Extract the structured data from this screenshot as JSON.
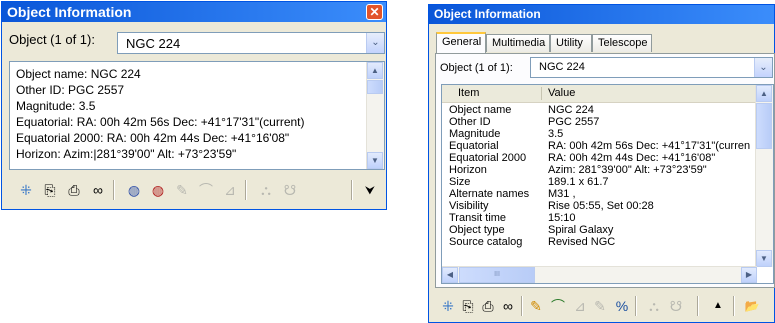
{
  "left_window": {
    "title": "Object Information",
    "close": "✕",
    "object_label": "Object (1 of 1):",
    "object_value": "NGC 224",
    "combo_arrow": "⌄",
    "text_lines": [
      "Object name: NGC 224",
      "Other ID: PGC 2557",
      "Magnitude: 3.5",
      "Equatorial: RA: 00h 42m 56s  Dec: +41°17'31\"(current)",
      "Equatorial 2000: RA: 00h 42m 44s  Dec: +41°16'08\"",
      "Horizon: Azim:|281°39'00\"  Alt: +73°23'59\""
    ],
    "scroll_up": "▲",
    "scroll_down": "▼",
    "toolbar": {
      "center": "⁜",
      "copy": "⎘",
      "print": "⎙",
      "binoculars": "∞",
      "globe_blue": "◍",
      "globe_red": "◍",
      "tool_a": "✎",
      "tool_b": "⌒",
      "tool_c": "⊿",
      "tool_d": "⛬",
      "tool_e": "☋",
      "more": "⮟"
    }
  },
  "right_window": {
    "title": "Object Information",
    "tabs": [
      "General",
      "Multimedia",
      "Utility",
      "Telescope"
    ],
    "object_label": "Object (1 of 1):",
    "object_value": "NGC 224",
    "combo_arrow": "⌄",
    "columns": [
      "Item",
      "Value"
    ],
    "rows": [
      [
        "Object name",
        "NGC 224"
      ],
      [
        "Other ID",
        "PGC 2557"
      ],
      [
        "Magnitude",
        "3.5"
      ],
      [
        "Equatorial",
        "RA: 00h 42m 56s  Dec: +41°17'31\"(curren"
      ],
      [
        "Equatorial 2000",
        "RA: 00h 42m 44s  Dec: +41°16'08\""
      ],
      [
        "Horizon",
        "Azim: 281°39'00\"  Alt: +73°23'59\""
      ],
      [
        "Size",
        "189.1 x 61.7"
      ],
      [
        "Alternate names",
        "M31 ,"
      ],
      [
        "Visibility",
        "Rise 05:55, Set 00:28"
      ],
      [
        "Transit time",
        "15:10"
      ],
      [
        "Object type",
        "Spiral Galaxy"
      ],
      [
        "Source catalog",
        "Revised NGC"
      ]
    ],
    "scroll_up": "▲",
    "scroll_down": "▼",
    "scroll_left": "◀",
    "scroll_right": "▶",
    "hthumb_grip": "III",
    "toolbar": {
      "center": "⁜",
      "copy": "⎘",
      "print": "⎙",
      "binoculars": "∞",
      "tool_a": "✎",
      "tool_b": "⌒",
      "tool_c": "⊿",
      "tool_d": "✎",
      "tool_e": "%",
      "tool_f": "⛬",
      "tool_g": "☋",
      "up": "▲",
      "open": "📂"
    }
  }
}
